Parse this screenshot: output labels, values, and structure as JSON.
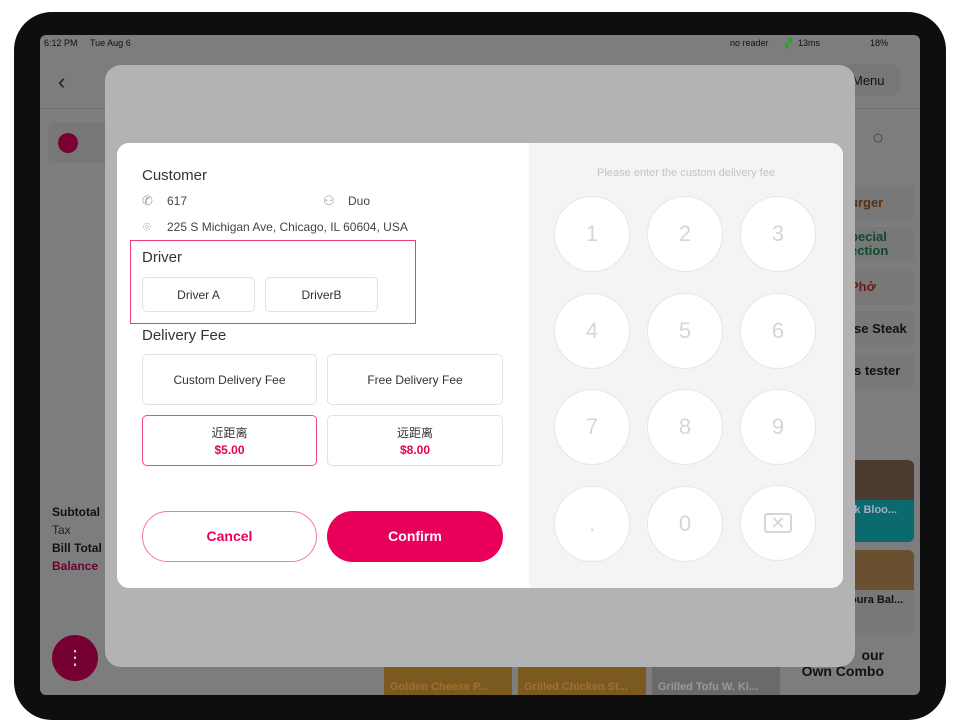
{
  "status_bar": {
    "time": "6:12 PM",
    "date": "Tue Aug 6",
    "reader": "no reader",
    "latency": "13ms",
    "battery": "18%"
  },
  "background": {
    "menu_label": "Menu",
    "categories": [
      "urger",
      "pecial\nection",
      "Phở",
      "se Steak",
      "s tester"
    ],
    "category_colors": [
      "#a05a1e",
      "#1e7a4a",
      "#b83232",
      "#222",
      "#222"
    ],
    "summary": {
      "subtotal": "Subtotal",
      "tax": "Tax",
      "bill_total": "Bill Total",
      "balance": "Balance"
    },
    "items": [
      "Golden Cheese P...",
      "Grilled Chicken St...",
      "Grilled Tofu W. Ki..."
    ],
    "side_items": [
      "rk Bloo...",
      "oura Bal..."
    ],
    "combo": "our\nOwn Combo"
  },
  "dialog": {
    "customer": {
      "heading": "Customer",
      "phone": "617",
      "name": "Duo",
      "address": "225 S Michigan Ave, Chicago, IL 60604, USA"
    },
    "driver": {
      "heading": "Driver",
      "options": [
        "Driver A",
        "DriverB"
      ]
    },
    "delivery_fee": {
      "heading": "Delivery Fee",
      "custom": "Custom Delivery Fee",
      "free": "Free Delivery Fee",
      "presets": [
        {
          "label": "近距离",
          "price": "$5.00",
          "selected": true
        },
        {
          "label": "远距离",
          "price": "$8.00",
          "selected": false
        }
      ]
    },
    "cancel": "Cancel",
    "confirm": "Confirm",
    "keypad": {
      "placeholder": "Please enter the custom delivery fee",
      "keys": [
        "1",
        "2",
        "3",
        "4",
        "5",
        "6",
        "7",
        "8",
        "9",
        ".",
        "0"
      ]
    }
  },
  "colors": {
    "accent": "#e8005a",
    "highlight": "#ee4b7f"
  }
}
